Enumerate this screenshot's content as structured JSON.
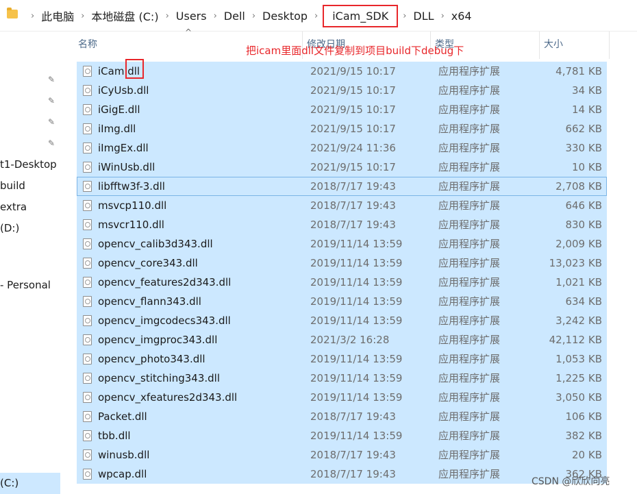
{
  "address": {
    "crumbs": [
      "此电脑",
      "本地磁盘 (C:)",
      "Users",
      "Dell",
      "Desktop",
      "iCam_SDK",
      "DLL",
      "x64"
    ],
    "separator": "›",
    "highlighted": "iCam_SDK"
  },
  "nav": {
    "items": [
      "t1-Desktop",
      "build",
      "extra",
      "(D:)",
      "- Personal"
    ],
    "selected": "(C:)"
  },
  "columns": {
    "name": "名称",
    "date": "修改日期",
    "type": "类型",
    "size": "大小"
  },
  "annotation": "把icam里面dll文件复制到项目build下debug下",
  "files": [
    {
      "name": "iCam.dll",
      "date": "2021/9/15 10:17",
      "type": "应用程序扩展",
      "size": "4,781 KB"
    },
    {
      "name": "iCyUsb.dll",
      "date": "2021/9/15 10:17",
      "type": "应用程序扩展",
      "size": "34 KB"
    },
    {
      "name": "iGigE.dll",
      "date": "2021/9/15 10:17",
      "type": "应用程序扩展",
      "size": "14 KB"
    },
    {
      "name": "iImg.dll",
      "date": "2021/9/15 10:17",
      "type": "应用程序扩展",
      "size": "662 KB"
    },
    {
      "name": "iImgEx.dll",
      "date": "2021/9/24 11:36",
      "type": "应用程序扩展",
      "size": "330 KB"
    },
    {
      "name": "iWinUsb.dll",
      "date": "2021/9/15 10:17",
      "type": "应用程序扩展",
      "size": "10 KB"
    },
    {
      "name": "libfftw3f-3.dll",
      "date": "2018/7/17 19:43",
      "type": "应用程序扩展",
      "size": "2,708 KB"
    },
    {
      "name": "msvcp110.dll",
      "date": "2018/7/17 19:43",
      "type": "应用程序扩展",
      "size": "646 KB"
    },
    {
      "name": "msvcr110.dll",
      "date": "2018/7/17 19:43",
      "type": "应用程序扩展",
      "size": "830 KB"
    },
    {
      "name": "opencv_calib3d343.dll",
      "date": "2019/11/14 13:59",
      "type": "应用程序扩展",
      "size": "2,009 KB"
    },
    {
      "name": "opencv_core343.dll",
      "date": "2019/11/14 13:59",
      "type": "应用程序扩展",
      "size": "13,023 KB"
    },
    {
      "name": "opencv_features2d343.dll",
      "date": "2019/11/14 13:59",
      "type": "应用程序扩展",
      "size": "1,021 KB"
    },
    {
      "name": "opencv_flann343.dll",
      "date": "2019/11/14 13:59",
      "type": "应用程序扩展",
      "size": "634 KB"
    },
    {
      "name": "opencv_imgcodecs343.dll",
      "date": "2019/11/14 13:59",
      "type": "应用程序扩展",
      "size": "3,242 KB"
    },
    {
      "name": "opencv_imgproc343.dll",
      "date": "2021/3/2 16:28",
      "type": "应用程序扩展",
      "size": "42,112 KB"
    },
    {
      "name": "opencv_photo343.dll",
      "date": "2019/11/14 13:59",
      "type": "应用程序扩展",
      "size": "1,053 KB"
    },
    {
      "name": "opencv_stitching343.dll",
      "date": "2019/11/14 13:59",
      "type": "应用程序扩展",
      "size": "1,225 KB"
    },
    {
      "name": "opencv_xfeatures2d343.dll",
      "date": "2019/11/14 13:59",
      "type": "应用程序扩展",
      "size": "3,050 KB"
    },
    {
      "name": "Packet.dll",
      "date": "2018/7/17 19:43",
      "type": "应用程序扩展",
      "size": "106 KB"
    },
    {
      "name": "tbb.dll",
      "date": "2019/11/14 13:59",
      "type": "应用程序扩展",
      "size": "382 KB"
    },
    {
      "name": "winusb.dll",
      "date": "2018/7/17 19:43",
      "type": "应用程序扩展",
      "size": "20 KB"
    },
    {
      "name": "wpcap.dll",
      "date": "2018/7/17 19:43",
      "type": "应用程序扩展",
      "size": "362 KB"
    }
  ],
  "focused_row": 6,
  "watermark": "CSDN @欣欣向亮",
  "icons": {
    "folder": "folder-icon",
    "pin": "pin-icon",
    "file": "dll-file-icon",
    "sort": "sort-up-icon"
  },
  "colors": {
    "selection": "#cce8ff",
    "highlight": "#e8262a",
    "focus": "#7ab4e6"
  }
}
